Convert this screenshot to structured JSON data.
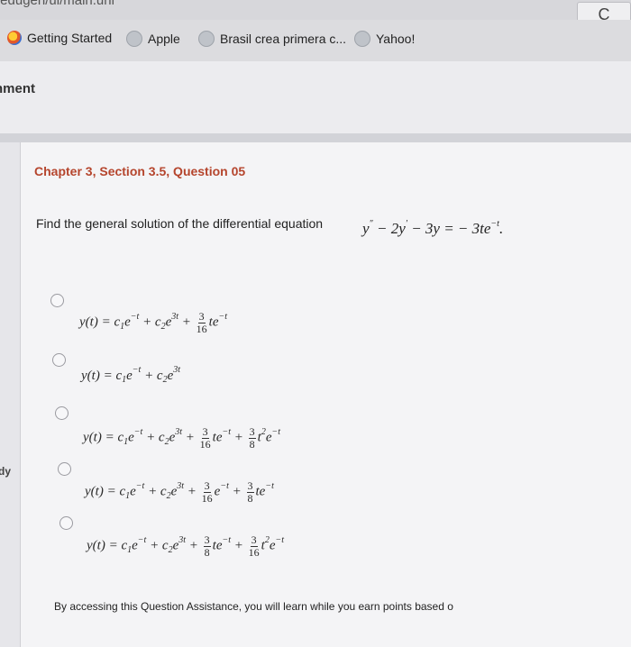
{
  "browser": {
    "url_fragment": "/edugen/ui/main.uni",
    "reload_label": "C",
    "bookmarks": [
      {
        "label": "Getting Started",
        "icon": "firefox-icon"
      },
      {
        "label": "Apple",
        "icon": "globe-icon"
      },
      {
        "label": "Brasil crea primera c...",
        "icon": "globe-icon"
      },
      {
        "label": "Yahoo!",
        "icon": "globe-icon"
      }
    ]
  },
  "app": {
    "assignment_title": "nment",
    "side_label": "dy"
  },
  "question": {
    "title": "Chapter 3, Section 3.5, Question 05",
    "prompt": "Find the general solution of the differential equation",
    "equation": {
      "lhs_a": "y",
      "prime_a": "″",
      "op1": "− 2y",
      "prime_b": "′",
      "op2": "− 3y  =  − 3te",
      "exp": "−t",
      "end": "."
    },
    "options": [
      {
        "t1": "y(t) = c",
        "s1": "1",
        "t2": "e",
        "e1": "−t",
        "t3": " + c",
        "s2": "2",
        "t4": "e",
        "e2": "3t",
        "t5": " + ",
        "f1n": "3",
        "f1d": "16",
        "t6": "te",
        "e3": "−t"
      },
      {
        "t1": "y(t) = c",
        "s1": "1",
        "t2": "e",
        "e1": "−t",
        "t3": " + c",
        "s2": "2",
        "t4": "e",
        "e2": "3t"
      },
      {
        "t1": "y(t) = c",
        "s1": "1",
        "t2": "e",
        "e1": "−t",
        "t3": " + c",
        "s2": "2",
        "t4": "e",
        "e2": "3t",
        "t5": " + ",
        "f1n": "3",
        "f1d": "16",
        "t6": "te",
        "e3": "−t",
        "t7": " + ",
        "f2n": "3",
        "f2d": "8",
        "t8": "t",
        "e4": "2",
        "t9": "e",
        "e5": "−t"
      },
      {
        "t1": "y(t) = c",
        "s1": "1",
        "t2": "e",
        "e1": "−t",
        "t3": " + c",
        "s2": "2",
        "t4": "e",
        "e2": "3t",
        "t5": " + ",
        "f1n": "3",
        "f1d": "16",
        "t6": "e",
        "e3": "−t",
        "t7": " + ",
        "f2n": "3",
        "f2d": "8",
        "t8": "te",
        "e4": "−t"
      },
      {
        "t1": "y(t) = c",
        "s1": "1",
        "t2": "e",
        "e1": "−t",
        "t3": " + c",
        "s2": "2",
        "t4": "e",
        "e2": "3t",
        "t5": " + ",
        "f1n": "3",
        "f1d": "8",
        "t6": "te",
        "e3": "−t",
        "t7": " + ",
        "f2n": "3",
        "f2d": "16",
        "t8": "t",
        "e4": "2",
        "t9": "e",
        "e5": "−t"
      }
    ]
  },
  "footer": {
    "text": "By accessing this Question Assistance, you will learn while you earn points based o"
  }
}
